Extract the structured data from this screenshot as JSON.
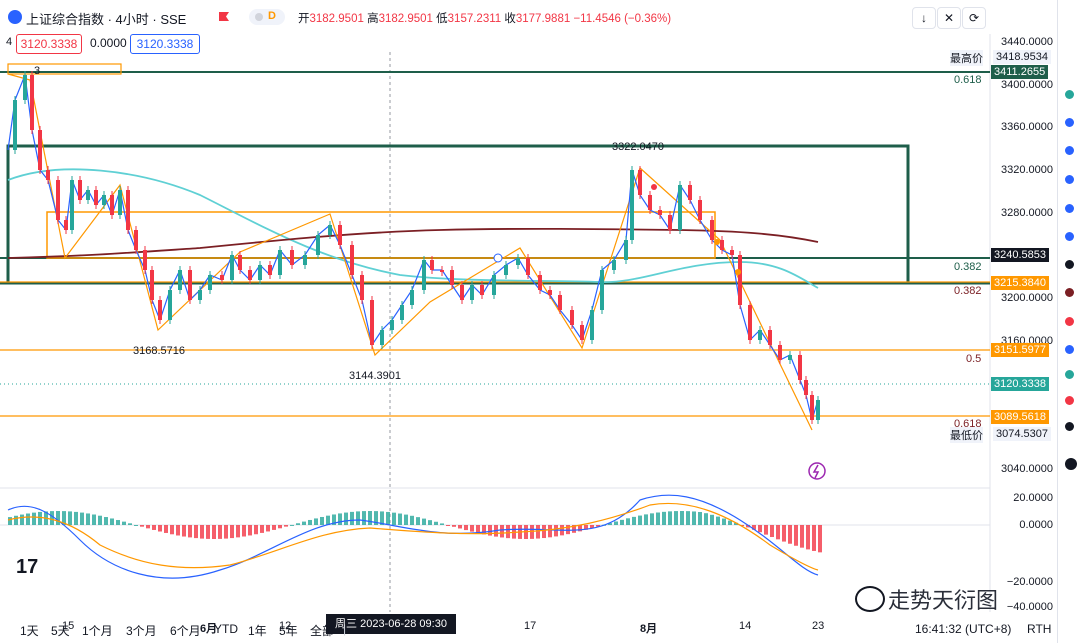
{
  "header": {
    "title": "上证综合指数 · 4小时 · SSE",
    "status_letter": "D",
    "ohlc": [
      {
        "k": "开",
        "v": "3182.9501"
      },
      {
        "k": "高",
        "v": "3182.9501"
      },
      {
        "k": "低",
        "v": "3157.2311"
      },
      {
        "k": "收",
        "v": "3177.9881"
      },
      {
        "k": "",
        "v": "−11.4546 (−0.36%)"
      }
    ],
    "buttons": [
      "↓",
      "✕",
      "⟳"
    ]
  },
  "price_row": {
    "indicator_num": "4",
    "sell_price": "3120.3338",
    "spread": "0.0000",
    "buy_price": "3120.3338"
  },
  "chart": {
    "price_axis_ticks": [
      "3440.0000",
      "3400.0000",
      "3360.0000",
      "3320.0000",
      "3280.0000",
      "3240.0000",
      "3200.0000",
      "3160.0000",
      "3120.0000",
      "3080.0000",
      "3040.0000"
    ],
    "macd_axis_ticks": [
      "20.0000",
      "0.0000",
      "−20.0000",
      "−40.0000"
    ],
    "tags": [
      {
        "label": "最高价",
        "value": "3418.9534"
      },
      {
        "label": "",
        "value": "3411.2655"
      },
      {
        "label": "",
        "value": "3240.5853"
      },
      {
        "label": "",
        "value": "3215.3840"
      },
      {
        "label": "",
        "value": "3151.5977"
      },
      {
        "label": "",
        "value": "3120.3338"
      },
      {
        "label": "",
        "value": "3089.5618"
      },
      {
        "label": "最低价",
        "value": "3074.5307"
      }
    ],
    "fib_labels": [
      "0.618",
      "0.382",
      "0.382",
      "0.5",
      "0.618"
    ],
    "annotations": [
      "3322.0470",
      "3168.5716",
      "3144.3901"
    ],
    "zigzag_label": "3"
  },
  "time_axis": {
    "labels": [
      "15",
      "6月",
      "12",
      "17",
      "8月",
      "14",
      "23"
    ],
    "cursor_date": "周三 2023-06-28   09:30"
  },
  "bottom_bar": {
    "ranges": [
      "1天",
      "5天",
      "1个月",
      "3个月",
      "6个月",
      "YTD",
      "1年",
      "5年",
      "全部"
    ],
    "clock": "16:41:32 (UTC+8)",
    "session": "RTH"
  },
  "watermark": "走势天衍图",
  "colors": {
    "up": "#26a69a",
    "down": "#f23645",
    "fib_orange": "#ff9800",
    "box_green": "#1e5e4a",
    "ma_teal": "#5fd0d4",
    "ma_maroon": "#7b1f24",
    "macd_blue": "#2962ff"
  }
}
